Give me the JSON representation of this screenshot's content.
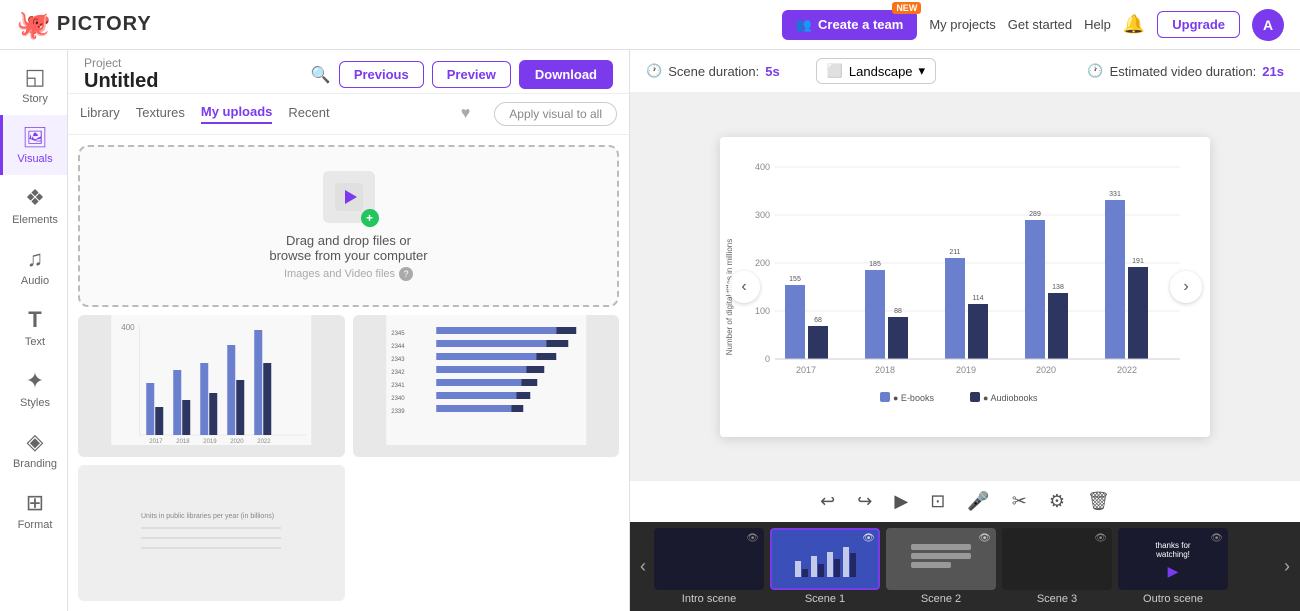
{
  "app": {
    "logo_text": "PICTORY",
    "logo_icon": "🐙"
  },
  "topnav": {
    "create_team_label": "Create a team",
    "badge_new": "NEW",
    "my_projects": "My projects",
    "get_started": "Get started",
    "help": "Help",
    "upgrade_label": "Upgrade",
    "avatar_letter": "A"
  },
  "project": {
    "label": "Project",
    "title": "Untitled"
  },
  "header_buttons": {
    "previous": "Previous",
    "preview": "Preview",
    "download": "Download"
  },
  "sidebar": {
    "items": [
      {
        "id": "story",
        "label": "Story",
        "icon": "◱"
      },
      {
        "id": "visuals",
        "label": "Visuals",
        "icon": "🖼"
      },
      {
        "id": "elements",
        "label": "Elements",
        "icon": "❖"
      },
      {
        "id": "audio",
        "label": "Audio",
        "icon": "♫"
      },
      {
        "id": "text",
        "label": "Text",
        "icon": "T"
      },
      {
        "id": "styles",
        "label": "Styles",
        "icon": "✦"
      },
      {
        "id": "branding",
        "label": "Branding",
        "icon": "◈"
      },
      {
        "id": "format",
        "label": "Format",
        "icon": "⊞"
      }
    ]
  },
  "visuals_panel": {
    "tabs": [
      {
        "id": "library",
        "label": "Library"
      },
      {
        "id": "textures",
        "label": "Textures"
      },
      {
        "id": "my_uploads",
        "label": "My uploads",
        "active": true
      },
      {
        "id": "recent",
        "label": "Recent"
      }
    ],
    "apply_visual_btn": "Apply visual to all",
    "upload": {
      "main_text": "Drag and drop files or",
      "sub_text": "browse from your computer",
      "file_types": "Images and Video files",
      "help_icon": "?"
    }
  },
  "preview": {
    "scene_duration_label": "Scene duration:",
    "scene_duration_val": "5s",
    "layout_label": "Landscape",
    "estimated_label": "Estimated video duration:",
    "estimated_val": "21s"
  },
  "chart": {
    "title": "",
    "y_label": "Number of digital titles in millions",
    "x_labels": [
      "2017",
      "2018",
      "2019",
      "2020",
      "2022"
    ],
    "series": [
      {
        "name": "E-books",
        "color": "#6b7fcf",
        "values": [
          155,
          185,
          211,
          289,
          331
        ]
      },
      {
        "name": "Audiobooks",
        "color": "#2d3561",
        "values": [
          68,
          88,
          114,
          138,
          191
        ]
      }
    ],
    "y_ticks": [
      0,
      100,
      200,
      300,
      400
    ],
    "legend": [
      "E-books",
      "Audiobooks"
    ]
  },
  "filmstrip": {
    "scenes": [
      {
        "id": "intro",
        "label": "Intro scene",
        "type": "dark"
      },
      {
        "id": "scene1",
        "label": "Scene 1",
        "type": "chart",
        "selected": true
      },
      {
        "id": "scene2",
        "label": "Scene 2",
        "type": "document"
      },
      {
        "id": "scene3",
        "label": "Scene 3",
        "type": "dark2"
      },
      {
        "id": "outro",
        "label": "Outro scene",
        "type": "outro"
      }
    ]
  },
  "toolbar": {
    "undo_icon": "↩",
    "redo_icon": "↪",
    "play_icon": "▶",
    "subtitle_icon": "⊡",
    "mic_icon": "🎤",
    "scissors_icon": "✂",
    "settings_icon": "⚙",
    "delete_icon": "🗑"
  }
}
